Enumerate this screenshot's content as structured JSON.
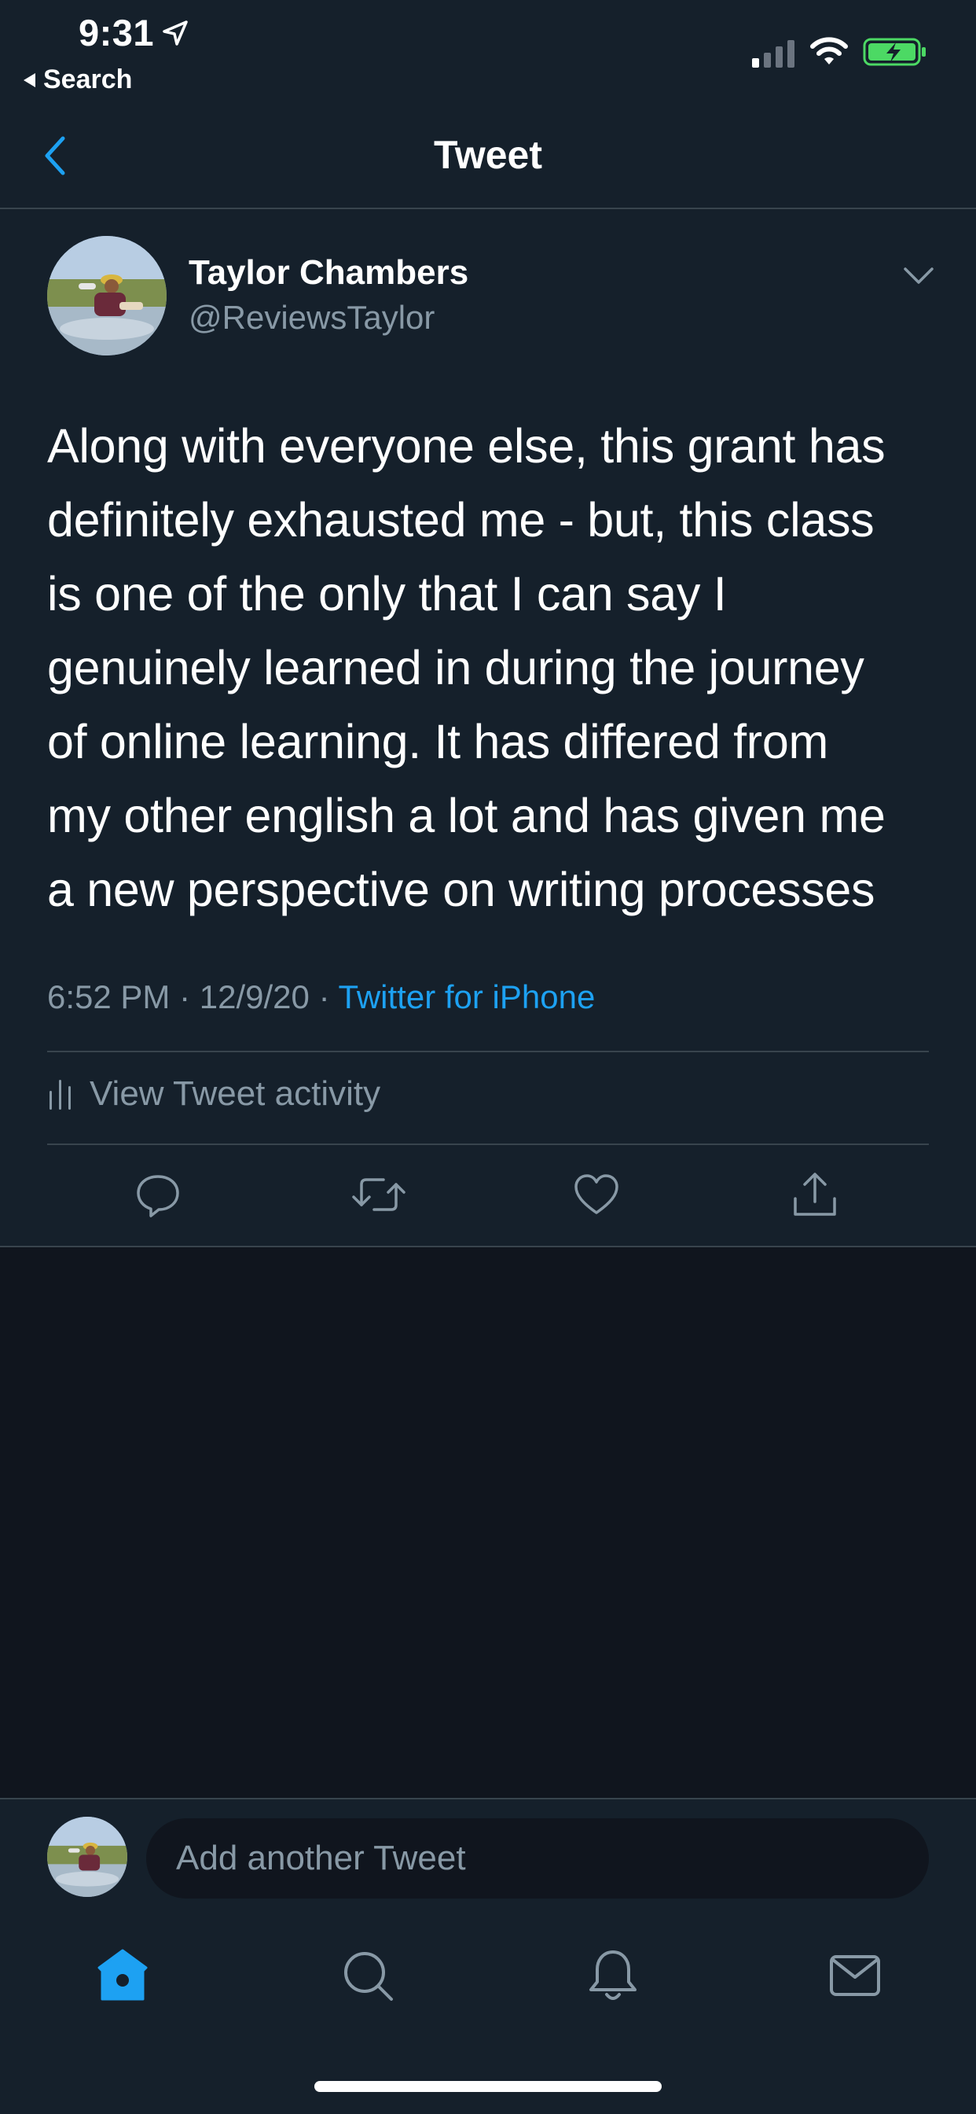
{
  "status_bar": {
    "time": "9:31",
    "back_app_label": "Search",
    "icons": [
      "location-arrow-icon",
      "cellular-signal-icon",
      "wifi-icon",
      "battery-charging-icon"
    ]
  },
  "nav": {
    "title": "Tweet",
    "back_icon": "chevron-left-icon"
  },
  "tweet": {
    "author_name": "Taylor Chambers",
    "author_handle": "@ReviewsTaylor",
    "text_lines": [
      "Along with everyone else, this grant has",
      "definitely exhausted me - but, this class",
      "is one of the only that I can say I",
      "genuinely learned in during the journey",
      "of online learning. It has differed from",
      "my other english a lot and has given me",
      "a new perspective on writing processes"
    ],
    "time": "6:52 PM",
    "separator": "·",
    "date": "12/9/20",
    "source": "Twitter for iPhone",
    "activity_label": "View Tweet activity",
    "actions": [
      "reply-icon",
      "retweet-icon",
      "like-icon",
      "share-icon"
    ]
  },
  "compose": {
    "placeholder": "Add another Tweet"
  },
  "tab_bar": {
    "tabs": [
      "home-icon",
      "search-icon",
      "notifications-icon",
      "messages-icon"
    ],
    "active_tab": "home-icon"
  },
  "colors": {
    "background": "#10151e",
    "surface": "#15202b",
    "accent": "#1da1f2",
    "secondary_text": "#8899a6",
    "battery": "#4cd964"
  }
}
